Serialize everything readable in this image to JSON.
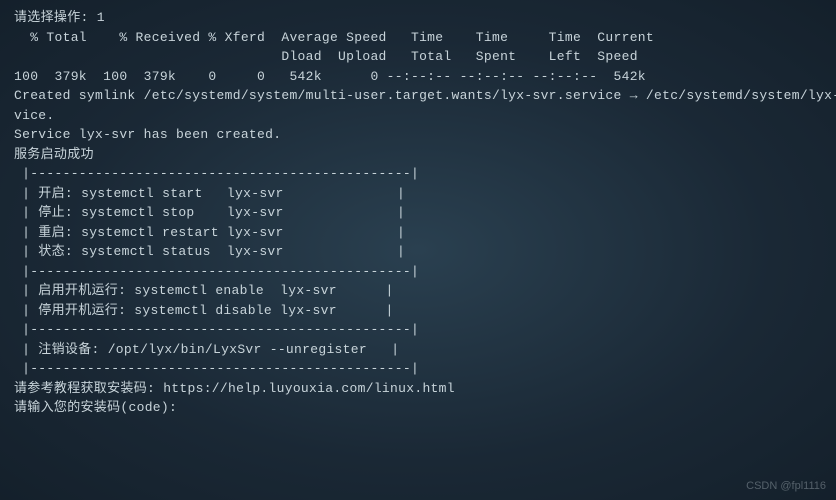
{
  "lines": {
    "l0": "请选择操作: 1",
    "l1": "  % Total    % Received % Xferd  Average Speed   Time    Time     Time  Current",
    "l2": "                                 Dload  Upload   Total   Spent    Left  Speed",
    "l3": "100  379k  100  379k    0     0   542k      0 --:--:-- --:--:-- --:--:--  542k",
    "l4": "Created symlink /etc/systemd/system/multi-user.target.wants/lyx-svr.service → /etc/systemd/system/lyx-svr.ser",
    "l5": "vice.",
    "l6": "Service lyx-svr has been created.",
    "l7": "",
    "l8": "服务启动成功",
    "l9": "",
    "l10": " |-----------------------------------------------|",
    "l11": " | 开启: systemctl start   lyx-svr              |",
    "l12": " | 停止: systemctl stop    lyx-svr              |",
    "l13": " | 重启: systemctl restart lyx-svr              |",
    "l14": " | 状态: systemctl status  lyx-svr              |",
    "l15": " |-----------------------------------------------|",
    "l16": " | 启用开机运行: systemctl enable  lyx-svr      |",
    "l17": " | 停用开机运行: systemctl disable lyx-svr      |",
    "l18": " |-----------------------------------------------|",
    "l19": " | 注销设备: /opt/lyx/bin/LyxSvr --unregister   |",
    "l20": " |-----------------------------------------------|",
    "l21": "",
    "l22": "请参考教程获取安装码: https://help.luyouxia.com/linux.html",
    "l23": "请输入您的安装码(code):"
  },
  "watermark": "CSDN @fpl1116"
}
